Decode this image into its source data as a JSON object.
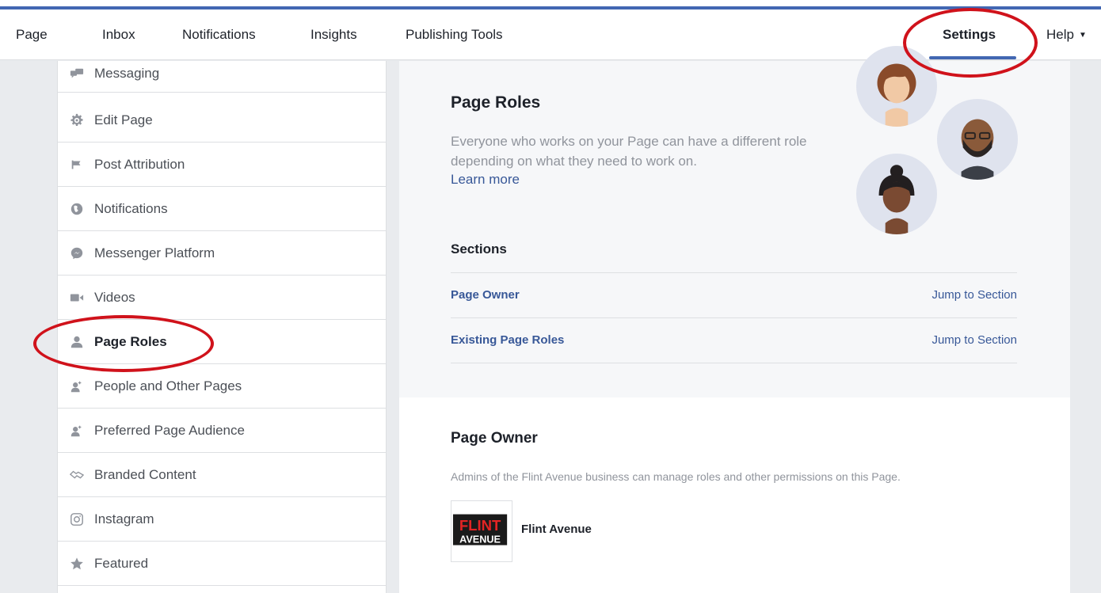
{
  "nav": {
    "items": [
      {
        "label": "Page"
      },
      {
        "label": "Inbox"
      },
      {
        "label": "Notifications"
      },
      {
        "label": "Insights"
      },
      {
        "label": "Publishing Tools"
      },
      {
        "label": "Settings"
      },
      {
        "label": "Help"
      }
    ],
    "active": "Settings"
  },
  "sidebar": {
    "items": [
      {
        "label": "Messaging",
        "icon": "messaging-icon"
      },
      {
        "label": "Edit Page",
        "icon": "gear-icon"
      },
      {
        "label": "Post Attribution",
        "icon": "flag-icon"
      },
      {
        "label": "Notifications",
        "icon": "globe-icon"
      },
      {
        "label": "Messenger Platform",
        "icon": "messenger-icon"
      },
      {
        "label": "Videos",
        "icon": "video-camera-icon"
      },
      {
        "label": "Page Roles",
        "icon": "person-icon"
      },
      {
        "label": "People and Other Pages",
        "icon": "people-icon"
      },
      {
        "label": "Preferred Page Audience",
        "icon": "people-icon"
      },
      {
        "label": "Branded Content",
        "icon": "handshake-icon"
      },
      {
        "label": "Instagram",
        "icon": "instagram-icon"
      },
      {
        "label": "Featured",
        "icon": "star-icon"
      }
    ],
    "selected": "Page Roles"
  },
  "main": {
    "title": "Page Roles",
    "description": "Everyone who works on your Page can have a different role depending on what they need to work on.",
    "learn_more": "Learn more",
    "sections_title": "Sections",
    "sections": [
      {
        "name": "Page Owner",
        "jump": "Jump to Section"
      },
      {
        "name": "Existing Page Roles",
        "jump": "Jump to Section"
      }
    ],
    "owner": {
      "title": "Page Owner",
      "description": "Admins of the Flint Avenue business can manage roles and other permissions on this Page.",
      "name": "Flint Avenue",
      "logo_text_top": "FLINT",
      "logo_text_bottom": "AVENUE"
    }
  },
  "colors": {
    "accent": "#4267b2",
    "link": "#385898",
    "annotation": "#d0121b"
  }
}
